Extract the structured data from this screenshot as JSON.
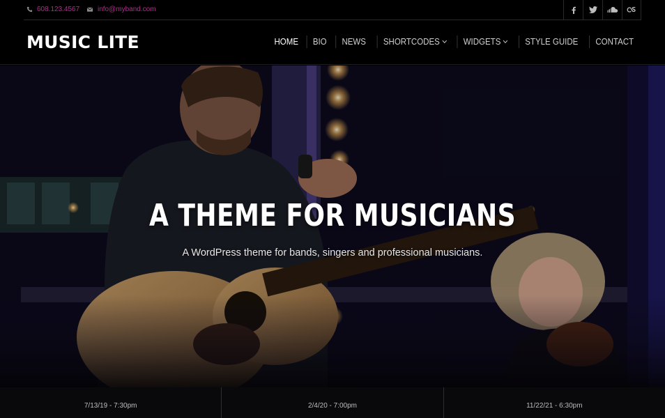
{
  "topbar": {
    "phone": "608.123.4567",
    "email": "info@myband.com",
    "social_icons": [
      "facebook-icon",
      "twitter-icon",
      "soundcloud-icon",
      "lastfm-icon"
    ]
  },
  "header": {
    "logo": "MUSIC LITE",
    "nav": [
      {
        "label": "HOME",
        "active": true
      },
      {
        "label": "BIO"
      },
      {
        "label": "NEWS"
      },
      {
        "label": "SHORTCODES",
        "dropdown": true
      },
      {
        "label": "WIDGETS",
        "dropdown": true
      },
      {
        "label": "STYLE GUIDE"
      },
      {
        "label": "CONTACT"
      }
    ]
  },
  "hero": {
    "title": "A THEME FOR MUSICIANS",
    "subtitle": "A WordPress theme for bands, singers and professional musicians."
  },
  "events": [
    {
      "date": "7/13/19 - 7:30pm"
    },
    {
      "date": "2/4/20 - 7:00pm"
    },
    {
      "date": "11/22/21 - 6:30pm"
    }
  ],
  "colors": {
    "accent": "#b42b8f",
    "background": "#000000"
  }
}
